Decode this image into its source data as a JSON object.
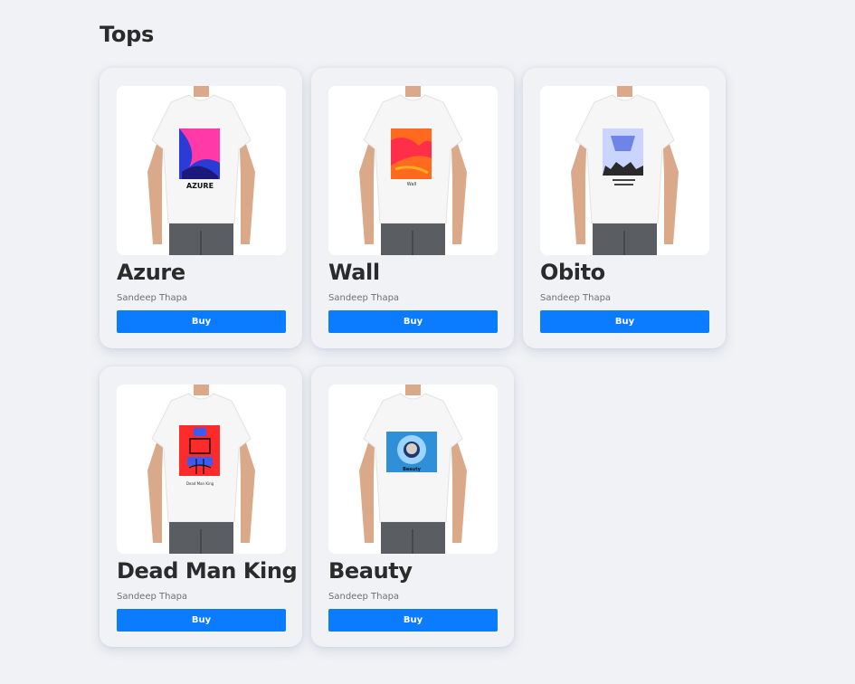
{
  "page": {
    "title": "Tops"
  },
  "colors": {
    "background": "#f0f2f6",
    "accent": "#0b7bff",
    "text": "#2b2b2b",
    "muted": "#6e7076"
  },
  "products": [
    {
      "name": "Azure",
      "artist": "Sandeep Thapa",
      "buy_label": "Buy",
      "print_caption": "AZURE",
      "print_colors": [
        "#2b3bd6",
        "#ff3aa8",
        "#1a1a7a"
      ]
    },
    {
      "name": "Wall",
      "artist": "Sandeep Thapa",
      "buy_label": "Buy",
      "print_caption": "Wall",
      "print_colors": [
        "#ff6a1f",
        "#ff2f4a",
        "#ffb020"
      ]
    },
    {
      "name": "Obito",
      "artist": "Sandeep Thapa",
      "buy_label": "Buy",
      "print_caption": "",
      "print_colors": [
        "#c9d4ff",
        "#6f84e8",
        "#2a2a2a"
      ]
    },
    {
      "name": "Dead Man King",
      "artist": "Sandeep Thapa",
      "buy_label": "Buy",
      "print_caption": "Dead Man King",
      "print_colors": [
        "#ff2a2a",
        "#3a5cf0",
        "#111111"
      ]
    },
    {
      "name": "Beauty",
      "artist": "Sandeep Thapa",
      "buy_label": "Buy",
      "print_caption": "Beauty",
      "print_colors": [
        "#2f8fd8",
        "#9ad4ff",
        "#1f3a6a"
      ]
    }
  ]
}
